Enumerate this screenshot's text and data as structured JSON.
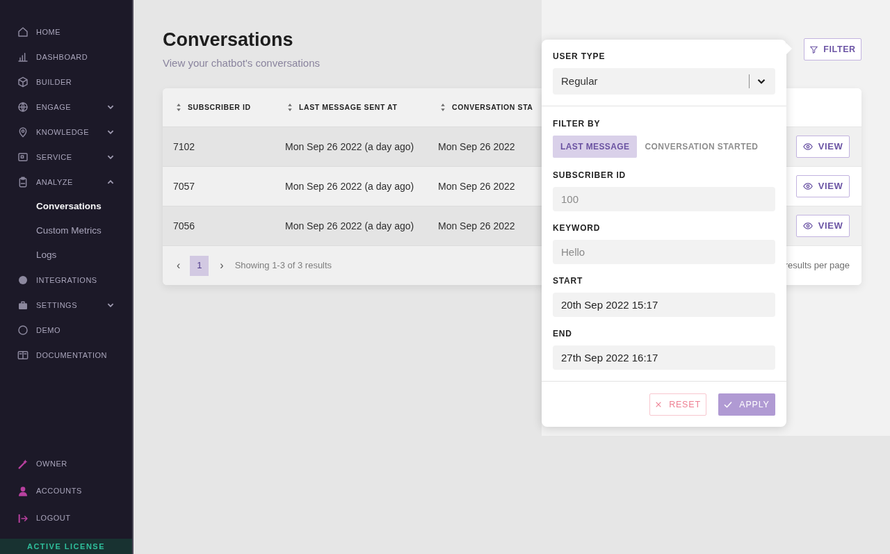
{
  "sidebar": {
    "items": [
      {
        "label": "HOME"
      },
      {
        "label": "DASHBOARD"
      },
      {
        "label": "BUILDER"
      },
      {
        "label": "ENGAGE",
        "expanded": false
      },
      {
        "label": "KNOWLEDGE",
        "expanded": false
      },
      {
        "label": "SERVICE",
        "expanded": false
      },
      {
        "label": "ANALYZE",
        "expanded": true,
        "children": [
          {
            "label": "Conversations",
            "selected": true
          },
          {
            "label": "Custom Metrics",
            "selected": false
          },
          {
            "label": "Logs",
            "selected": false
          }
        ]
      },
      {
        "label": "INTEGRATIONS"
      },
      {
        "label": "SETTINGS",
        "expanded": false
      },
      {
        "label": "DEMO"
      },
      {
        "label": "DOCUMENTATION"
      }
    ],
    "bottom_items": [
      {
        "label": "OWNER"
      },
      {
        "label": "ACCOUNTS"
      },
      {
        "label": "LOGOUT"
      }
    ],
    "license": "ACTIVE LICENSE"
  },
  "page": {
    "title": "Conversations",
    "subtitle": "View your chatbot's conversations"
  },
  "filter_button": {
    "label": "FILTER"
  },
  "table": {
    "columns": [
      "SUBSCRIBER ID",
      "LAST MESSAGE SENT AT",
      "CONVERSATION STA"
    ],
    "rows": [
      {
        "cells": [
          "7102",
          "Mon Sep 26 2022 (a day ago)",
          "Mon Sep 26 2022"
        ],
        "action": "VIEW"
      },
      {
        "cells": [
          "7057",
          "Mon Sep 26 2022 (a day ago)",
          "Mon Sep 26 2022"
        ],
        "action": "VIEW"
      },
      {
        "cells": [
          "7056",
          "Mon Sep 26 2022 (a day ago)",
          "Mon Sep 26 2022"
        ],
        "action": "VIEW"
      }
    ],
    "pagination": {
      "prev": "‹",
      "pages": [
        {
          "label": "1",
          "selected": true
        }
      ],
      "next": "›",
      "summary": "Showing 1-3 of 3 results"
    },
    "page_size_label": "results per page"
  },
  "filter_panel": {
    "user_type": {
      "label": "USER TYPE",
      "value": "Regular"
    },
    "filter_by": {
      "label": "FILTER BY",
      "options": [
        {
          "label": "LAST MESSAGE",
          "selected": true
        },
        {
          "label": "CONVERSATION STARTED",
          "selected": false
        }
      ]
    },
    "fields": [
      {
        "label": "SUBSCRIBER ID",
        "placeholder": "100"
      },
      {
        "label": "KEYWORD",
        "placeholder": "Hello"
      },
      {
        "label": "START",
        "value": "20th Sep 2022 15:17"
      },
      {
        "label": "END",
        "value": "27th Sep 2022 16:17"
      }
    ],
    "reset": "RESET",
    "apply": "APPLY"
  }
}
